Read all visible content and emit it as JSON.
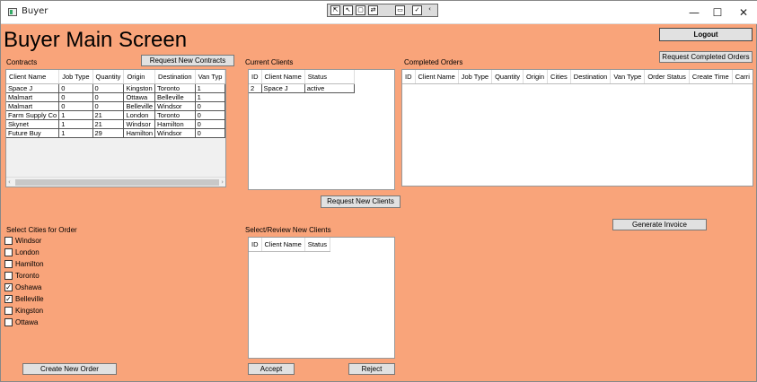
{
  "window": {
    "title": "Buyer",
    "minimize": "—",
    "maximize": "☐",
    "close": "✕"
  },
  "debug_toolbar": [
    "⇱",
    "↖",
    "▢",
    "⇄",
    "▭",
    "✓",
    "‹"
  ],
  "header": {
    "title": "Buyer Main Screen",
    "logout_label": "Logout",
    "request_completed_label": "Request Completed Orders"
  },
  "contracts": {
    "label": "Contracts",
    "request_button": "Request New Contracts",
    "columns": [
      "Client Name",
      "Job Type",
      "Quantity",
      "Origin",
      "Destination",
      "Van Typ"
    ],
    "rows": [
      [
        "Space J",
        "0",
        "0",
        "Kingston",
        "Toronto",
        "1"
      ],
      [
        "Malmart",
        "0",
        "0",
        "Ottawa",
        "Belleville",
        "1"
      ],
      [
        "Malmart",
        "0",
        "0",
        "Belleville",
        "Windsor",
        "0"
      ],
      [
        "Farm Supply Co",
        "1",
        "21",
        "London",
        "Toronto",
        "0"
      ],
      [
        "Skynet",
        "1",
        "21",
        "Windsor",
        "Hamilton",
        "0"
      ],
      [
        "Future Buy",
        "1",
        "29",
        "Hamilton",
        "Windsor",
        "0"
      ]
    ]
  },
  "current_clients": {
    "label": "Current Clients",
    "columns": [
      "ID",
      "Client Name",
      "Status"
    ],
    "rows": [
      [
        "2",
        "Space J",
        "active"
      ]
    ],
    "request_button": "Request New Clients"
  },
  "completed_orders": {
    "label": "Completed Orders",
    "columns": [
      "ID",
      "Client Name",
      "Job Type",
      "Quantity",
      "Origin",
      "Cities",
      "Destination",
      "Van Type",
      "Order Status",
      "Create Time",
      "Carri"
    ],
    "generate_invoice": "Generate Invoice"
  },
  "cities": {
    "label": "Select Cities for Order",
    "items": [
      {
        "name": "Windsor",
        "checked": false
      },
      {
        "name": "London",
        "checked": false
      },
      {
        "name": "Hamilton",
        "checked": false
      },
      {
        "name": "Toronto",
        "checked": false
      },
      {
        "name": "Oshawa",
        "checked": true
      },
      {
        "name": "Belleville",
        "checked": true
      },
      {
        "name": "Kingston",
        "checked": false
      },
      {
        "name": "Ottawa",
        "checked": false
      }
    ],
    "create_button": "Create New Order"
  },
  "new_clients": {
    "label": "Select/Review New Clients",
    "columns": [
      "ID",
      "Client Name",
      "Status"
    ],
    "accept": "Accept",
    "reject": "Reject"
  }
}
